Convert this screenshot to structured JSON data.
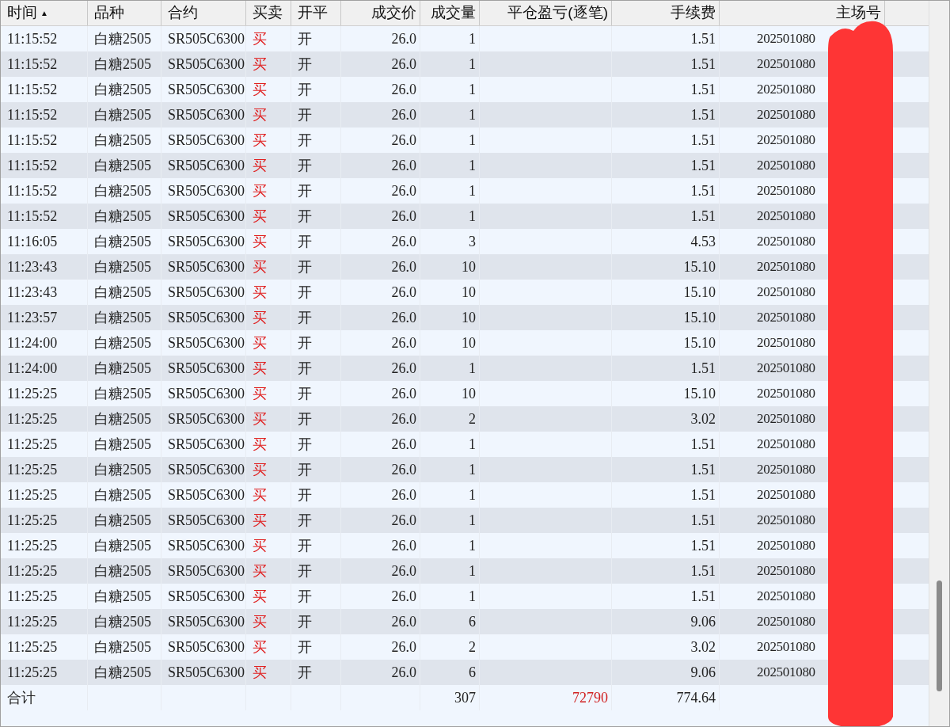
{
  "table": {
    "columns": [
      {
        "label": "时间",
        "sort_indicator": "▲"
      },
      {
        "label": "品种"
      },
      {
        "label": "合约"
      },
      {
        "label": "买卖"
      },
      {
        "label": "开平"
      },
      {
        "label": "成交价"
      },
      {
        "label": "成交量"
      },
      {
        "label": "平仓盈亏(逐笔)"
      },
      {
        "label": "手续费"
      },
      {
        "label": "主场号"
      }
    ],
    "rows": [
      [
        "11:15:52",
        "白糖2505",
        "SR505C6300",
        "买",
        "开",
        "26.0",
        "1",
        "",
        "1.51",
        "202501080"
      ],
      [
        "11:15:52",
        "白糖2505",
        "SR505C6300",
        "买",
        "开",
        "26.0",
        "1",
        "",
        "1.51",
        "202501080"
      ],
      [
        "11:15:52",
        "白糖2505",
        "SR505C6300",
        "买",
        "开",
        "26.0",
        "1",
        "",
        "1.51",
        "202501080"
      ],
      [
        "11:15:52",
        "白糖2505",
        "SR505C6300",
        "买",
        "开",
        "26.0",
        "1",
        "",
        "1.51",
        "202501080"
      ],
      [
        "11:15:52",
        "白糖2505",
        "SR505C6300",
        "买",
        "开",
        "26.0",
        "1",
        "",
        "1.51",
        "202501080"
      ],
      [
        "11:15:52",
        "白糖2505",
        "SR505C6300",
        "买",
        "开",
        "26.0",
        "1",
        "",
        "1.51",
        "202501080"
      ],
      [
        "11:15:52",
        "白糖2505",
        "SR505C6300",
        "买",
        "开",
        "26.0",
        "1",
        "",
        "1.51",
        "202501080"
      ],
      [
        "11:15:52",
        "白糖2505",
        "SR505C6300",
        "买",
        "开",
        "26.0",
        "1",
        "",
        "1.51",
        "202501080"
      ],
      [
        "11:16:05",
        "白糖2505",
        "SR505C6300",
        "买",
        "开",
        "26.0",
        "3",
        "",
        "4.53",
        "202501080"
      ],
      [
        "11:23:43",
        "白糖2505",
        "SR505C6300",
        "买",
        "开",
        "26.0",
        "10",
        "",
        "15.10",
        "202501080"
      ],
      [
        "11:23:43",
        "白糖2505",
        "SR505C6300",
        "买",
        "开",
        "26.0",
        "10",
        "",
        "15.10",
        "202501080"
      ],
      [
        "11:23:57",
        "白糖2505",
        "SR505C6300",
        "买",
        "开",
        "26.0",
        "10",
        "",
        "15.10",
        "202501080"
      ],
      [
        "11:24:00",
        "白糖2505",
        "SR505C6300",
        "买",
        "开",
        "26.0",
        "10",
        "",
        "15.10",
        "202501080"
      ],
      [
        "11:24:00",
        "白糖2505",
        "SR505C6300",
        "买",
        "开",
        "26.0",
        "1",
        "",
        "1.51",
        "202501080"
      ],
      [
        "11:25:25",
        "白糖2505",
        "SR505C6300",
        "买",
        "开",
        "26.0",
        "10",
        "",
        "15.10",
        "202501080"
      ],
      [
        "11:25:25",
        "白糖2505",
        "SR505C6300",
        "买",
        "开",
        "26.0",
        "2",
        "",
        "3.02",
        "202501080"
      ],
      [
        "11:25:25",
        "白糖2505",
        "SR505C6300",
        "买",
        "开",
        "26.0",
        "1",
        "",
        "1.51",
        "202501080"
      ],
      [
        "11:25:25",
        "白糖2505",
        "SR505C6300",
        "买",
        "开",
        "26.0",
        "1",
        "",
        "1.51",
        "202501080"
      ],
      [
        "11:25:25",
        "白糖2505",
        "SR505C6300",
        "买",
        "开",
        "26.0",
        "1",
        "",
        "1.51",
        "202501080"
      ],
      [
        "11:25:25",
        "白糖2505",
        "SR505C6300",
        "买",
        "开",
        "26.0",
        "1",
        "",
        "1.51",
        "202501080"
      ],
      [
        "11:25:25",
        "白糖2505",
        "SR505C6300",
        "买",
        "开",
        "26.0",
        "1",
        "",
        "1.51",
        "202501080"
      ],
      [
        "11:25:25",
        "白糖2505",
        "SR505C6300",
        "买",
        "开",
        "26.0",
        "1",
        "",
        "1.51",
        "202501080"
      ],
      [
        "11:25:25",
        "白糖2505",
        "SR505C6300",
        "买",
        "开",
        "26.0",
        "1",
        "",
        "1.51",
        "202501080"
      ],
      [
        "11:25:25",
        "白糖2505",
        "SR505C6300",
        "买",
        "开",
        "26.0",
        "6",
        "",
        "9.06",
        "202501080"
      ],
      [
        "11:25:25",
        "白糖2505",
        "SR505C6300",
        "买",
        "开",
        "26.0",
        "2",
        "",
        "3.02",
        "202501080"
      ],
      [
        "11:25:25",
        "白糖2505",
        "SR505C6300",
        "买",
        "开",
        "26.0",
        "6",
        "",
        "9.06",
        "202501080"
      ]
    ],
    "total": {
      "label": "合计",
      "volume": "307",
      "pnl": "72790",
      "fee": "774.64"
    }
  }
}
